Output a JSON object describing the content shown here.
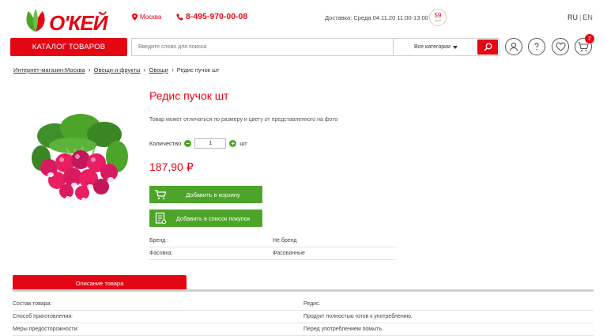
{
  "header": {
    "logo_text": "О'КЕЙ",
    "city": "Москва",
    "phone": "8-495-970-00-08",
    "delivery": "Доставка: Среда 04.11.20 11:00-13:00",
    "delivery_badge_number": "59",
    "delivery_badge_sub": "ДНЕЙ",
    "lang_ru": "RU",
    "lang_sep": "|",
    "lang_en": "EN"
  },
  "nav": {
    "catalog_label": "КАТАЛОГ ТОВАРОВ",
    "search_placeholder": "Введите слово для поиска",
    "category_label": "Все категории",
    "cart_count": "2"
  },
  "breadcrumbs": [
    "Интернет-магазин:Москва",
    "Овощи и фрукты",
    "Овощи",
    "Редис пучок шт"
  ],
  "product": {
    "title": "Редис пучок шт",
    "note": "Товар может отличаться по размеру и цвету от представленного на фото",
    "qty_label": "Количество",
    "qty_value": "1",
    "qty_unit": "шт",
    "price": "187,90 ₽",
    "add_to_cart": "Добавить в корзину",
    "add_to_list": "Добавить в список покупок",
    "attributes": [
      {
        "key": "Бренд :",
        "value": "Не бренд"
      },
      {
        "key": "Фасовка:",
        "value": "Фасованные"
      }
    ]
  },
  "tabs": {
    "description": "Описание товара"
  },
  "specs": [
    {
      "key": "Состав товара:",
      "value": "Редис."
    },
    {
      "key": "Способ приготовления:",
      "value": "Продукт полностью готов к употреблению."
    },
    {
      "key": "Меры предосторожности:",
      "value": "Перед употреблением помыть."
    }
  ],
  "colors": {
    "brand_red": "#e30613",
    "action_green": "#4ca529"
  }
}
